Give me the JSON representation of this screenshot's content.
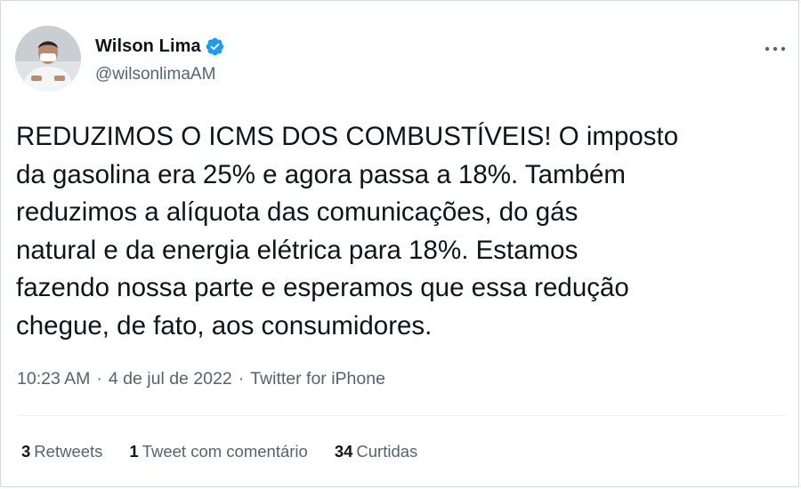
{
  "author": {
    "display_name": "Wilson Lima",
    "handle": "@wilsonlimaAM",
    "verified": true,
    "avatar_icon": "profile-photo"
  },
  "tweet": {
    "text": "REDUZIMOS O ICMS DOS COMBUSTÍVEIS! O imposto\nda gasolina era 25% e agora passa a 18%. Também\nreduzimos a alíquota das comunicações, do gás\nnatural e da energia elétrica para 18%. Estamos\nfazendo nossa parte e esperamos que essa redução\nchegue, de fato, aos consumidores.",
    "time": "10:23 AM",
    "date": "4 de jul de 2022",
    "source": "Twitter for iPhone",
    "separator": "·"
  },
  "stats": {
    "retweets_count": "3",
    "retweets_label": "Retweets",
    "quotes_count": "1",
    "quotes_label": "Tweet com comentário",
    "likes_count": "34",
    "likes_label": "Curtidas"
  },
  "colors": {
    "verified_blue": "#1d9bf0",
    "text_primary": "#0f1419",
    "text_secondary": "#536471",
    "border": "#cfd9de"
  }
}
